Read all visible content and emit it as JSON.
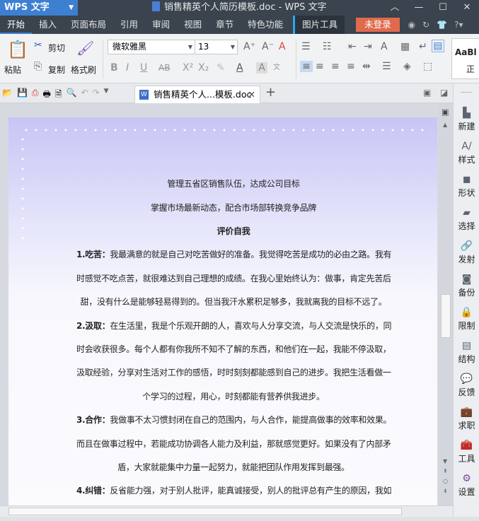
{
  "app": {
    "name": "WPS 文字",
    "window_title": "销售精英个人简历模板.doc - WPS 文字"
  },
  "menu": [
    "开始",
    "插入",
    "页面布局",
    "引用",
    "审阅",
    "视图",
    "章节",
    "特色功能",
    "图片工具"
  ],
  "login": "未登录",
  "ribbon": {
    "paste": "粘贴",
    "cut": "剪切",
    "copy": "复制",
    "format_painter": "格式刷",
    "font": "微软雅黑",
    "size": "13",
    "style_preview": "AaBl",
    "style_name": "正"
  },
  "tab": {
    "label": "销售精英个人...模板.doc"
  },
  "document": {
    "lines": [
      {
        "text": "管理五省区销售队伍，达成公司目标"
      },
      {
        "text": "掌握市场最新动态，配合市场部转换竞争品牌"
      },
      {
        "text": "评价自我",
        "bold": true
      },
      {
        "head": "1.吃苦：",
        "text": "我最满意的就是自己对吃苦做好的准备。我觉得吃苦是成功的必由之路。我有"
      },
      {
        "text": "时感觉不吃点苦，就很难达到自己理想的成绩。在我心里始终认为：做事，肯定先苦后"
      },
      {
        "text": "甜，没有什么是能够轻易得到的。但当我汗水累积足够多，我就离我的目标不远了。"
      },
      {
        "head": "2.汲取：",
        "text": "在生活里，我是个乐观开朗的人，喜欢与人分享交流，与人交流是快乐的，同"
      },
      {
        "text": "时会收获很多。每个人都有你我所不知不了解的东西，和他们在一起，我能不停汲取，"
      },
      {
        "text": "汲取经验，分享对生活对工作的感悟，时时刻刻都能感到自己的进步。我把生活看做一"
      },
      {
        "text": "个学习的过程，用心，时刻都能有营养供我进步。"
      },
      {
        "head": "3.合作：",
        "text": "我做事不太习惯封闭在自己的范围内，与人合作，能提高做事的效率和效果。"
      },
      {
        "text": "而且在做事过程中，若能成功协调各人能力及利益，那就感觉更好。如果没有了内部矛"
      },
      {
        "text": "盾，大家就能集中力量一起努力，就能把团队作用发挥到最强。"
      },
      {
        "head": "4.纠错：",
        "text": "反省能力强，对于别人批评，能真诚接受，别人的批评总有产生的原因，我如"
      }
    ]
  },
  "sidebar": [
    {
      "label": "新建",
      "icon": "new-doc-icon",
      "color": "#5d6470"
    },
    {
      "label": "样式",
      "icon": "style-icon",
      "color": "#5d6470"
    },
    {
      "label": "形状",
      "icon": "shape-icon",
      "color": "#5d6470"
    },
    {
      "label": "选择",
      "icon": "select-icon",
      "color": "#5d6470"
    },
    {
      "label": "发射",
      "icon": "link-icon",
      "color": "#5d6470"
    },
    {
      "label": "备份",
      "icon": "backup-icon",
      "color": "#5d6470"
    },
    {
      "label": "限制",
      "icon": "lock-icon",
      "color": "#5d6470"
    },
    {
      "label": "结构",
      "icon": "structure-icon",
      "color": "#5d6470"
    },
    {
      "label": "反馈",
      "icon": "feedback-icon",
      "color": "#5d6470"
    },
    {
      "label": "求职",
      "icon": "briefcase-icon",
      "color": "#4a7fd1"
    },
    {
      "label": "工具",
      "icon": "toolbox-icon",
      "color": "#d24b33"
    },
    {
      "label": "设置",
      "icon": "gear-icon",
      "color": "#7a4a9a"
    }
  ]
}
